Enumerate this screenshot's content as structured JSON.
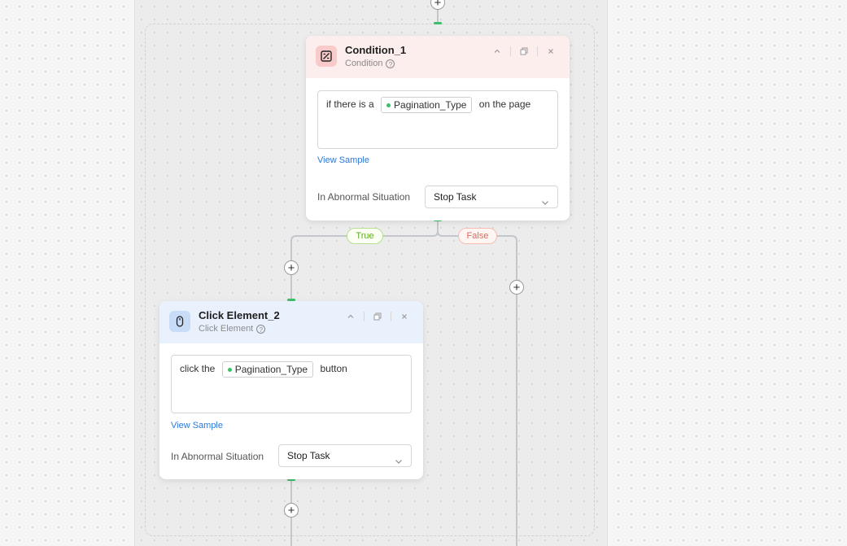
{
  "condition_node": {
    "title": "Condition_1",
    "subtitle": "Condition",
    "help_glyph": "?",
    "text_before": "if there is a",
    "chip_label": "Pagination_Type",
    "text_after": "on the page",
    "view_sample_label": "View Sample",
    "abnormal_label": "In Abnormal Situation",
    "abnormal_value": "Stop Task"
  },
  "branches": {
    "true_label": "True",
    "false_label": "False"
  },
  "click_node": {
    "title": "Click Element_2",
    "subtitle": "Click Element",
    "help_glyph": "?",
    "text_before": "click the",
    "chip_label": "Pagination_Type",
    "text_after": "button",
    "view_sample_label": "View Sample",
    "abnormal_label": "In Abnormal Situation",
    "abnormal_value": "Stop Task"
  },
  "add_step_glyph": "+",
  "icons": {
    "condition": "condition-icon",
    "click": "mouse-icon",
    "collapse": "chevron-up-icon",
    "duplicate": "copy-icon",
    "close": "close-icon",
    "dropdown": "chevron-down-icon"
  },
  "colors": {
    "connector": "#c3c7cd",
    "port": "#3cc06a",
    "condition_header": "#fdeeee",
    "click_header": "#e9f1fd",
    "true_badge": "#5fae22",
    "false_badge": "#e0685a",
    "link": "#2f77d6"
  }
}
